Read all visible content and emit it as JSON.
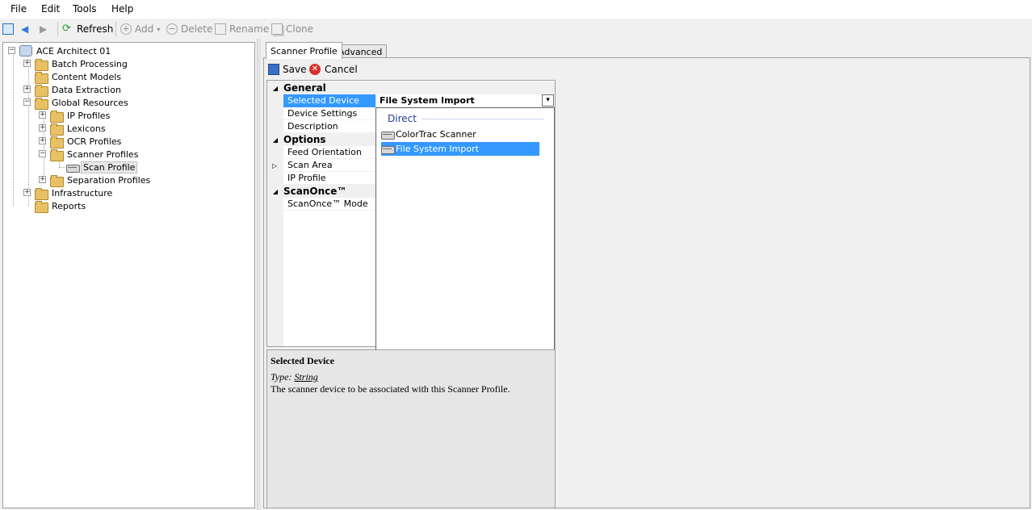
{
  "menu": [
    "File",
    "Edit",
    "Tools",
    "Help"
  ],
  "toolbar": {
    "refresh": "Refresh",
    "add": "Add",
    "delete": "Delete",
    "rename": "Rename",
    "clone": "Clone"
  },
  "tree": {
    "root": "ACE Architect 01",
    "batch_processing": "Batch Processing",
    "content_models": "Content Models",
    "data_extraction": "Data Extraction",
    "global_resources": "Global Resources",
    "ip_profiles": "IP Profiles",
    "lexicons": "Lexicons",
    "ocr_profiles": "OCR Profiles",
    "scanner_profiles": "Scanner Profiles",
    "scan_profile": "Scan Profile",
    "separation_profiles": "Separation Profiles",
    "infrastructure": "Infrastructure",
    "reports": "Reports"
  },
  "tabs": {
    "scanner_profile": "Scanner Profile",
    "advanced": "Advanced"
  },
  "actions": {
    "save": "Save",
    "cancel": "Cancel"
  },
  "property_grid": {
    "cat_general": "General",
    "selected_device": "Selected Device",
    "selected_device_value": "File System Import",
    "device_settings": "Device Settings",
    "description": "Description",
    "cat_options": "Options",
    "feed_orientation": "Feed Orientation",
    "scan_area": "Scan Area",
    "ip_profile": "IP Profile",
    "cat_scanonce": "ScanOnce™",
    "scanonce_mode": "ScanOnce™ Mode"
  },
  "dropdown": {
    "group": "Direct",
    "item1": "ColorTrac Scanner",
    "item2": "File System Import"
  },
  "help": {
    "title": "Selected Device",
    "type_label": "Type:",
    "type_value": "String",
    "text": "The scanner device to be associated with this Scanner Profile."
  },
  "colors": {
    "selection": "#3399ff",
    "folder": "#e8c066",
    "group_header": "#1e3c96"
  }
}
